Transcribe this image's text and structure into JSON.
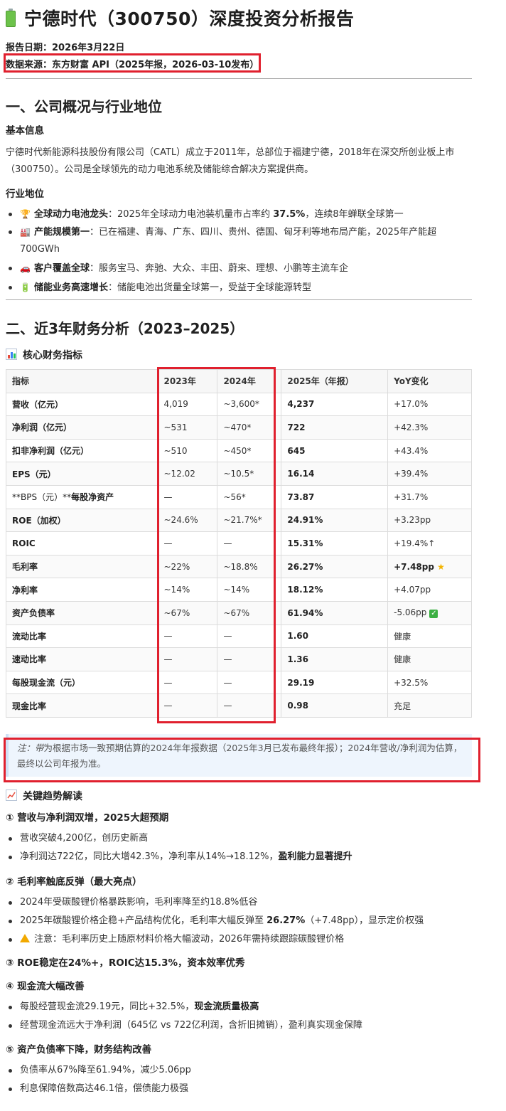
{
  "title": "宁德时代（300750）深度投资分析报告",
  "report_date": "报告日期：2026年3月22日",
  "data_source": "数据来源：东方财富 API（2025年报，2026-03-10发布）",
  "section1": {
    "heading": "一、公司概况与行业地位",
    "basic_title": "基本信息",
    "basic_text": "宁德时代新能源科技股份有限公司（CATL）成立于2011年，总部位于福建宁德，2018年在深交所创业板上市（300750）。公司是全球领先的动力电池系统及储能综合解决方案提供商。",
    "industry_title": "行业地位",
    "items": [
      {
        "icon": "trophy-icon",
        "emoji": "🏆",
        "bold": "全球动力电池龙头",
        "pre": "：2025年全球动力电池装机量市占率约 ",
        "hl": "37.5%",
        "post": "，连续8年蝉联全球第一"
      },
      {
        "icon": "factory-icon",
        "emoji": "🏭",
        "bold": "产能规模第一",
        "pre": "：已在福建、青海、广东、四川、贵州、德国、匈牙利等地布局产能，2025年产能超700GWh",
        "hl": "",
        "post": ""
      },
      {
        "icon": "car-icon",
        "emoji": "🚗",
        "bold": "客户覆盖全球",
        "pre": "：服务宝马、奔驰、大众、丰田、蔚来、理想、小鹏等主流车企",
        "hl": "",
        "post": ""
      },
      {
        "icon": "battery-icon",
        "emoji": "🔋",
        "bold": "储能业务高速增长",
        "pre": "：储能电池出货量全球第一，受益于全球能源转型",
        "hl": "",
        "post": ""
      }
    ]
  },
  "section2": {
    "heading": "二、近3年财务分析（2023–2025）",
    "table_title": "核心财务指标",
    "headers": [
      "指标",
      "2023年",
      "2024年",
      "2025年（年报）",
      "YoY变化"
    ],
    "rows": [
      [
        "营收（亿元）",
        "4,019",
        "~3,600*",
        "4,237",
        "+17.0%"
      ],
      [
        "净利润（亿元）",
        "~531",
        "~470*",
        "722",
        "+42.3%"
      ],
      [
        "扣非净利润（亿元）",
        "~510",
        "~450*",
        "645",
        "+43.4%"
      ],
      [
        "EPS（元）",
        "~12.02",
        "~10.5*",
        "16.14",
        "+39.4%"
      ],
      [
        "**BPS（元）**每股净资产",
        "—",
        "~56*",
        "73.87",
        "+31.7%"
      ],
      [
        "ROE（加权）",
        "~24.6%",
        "~21.7%*",
        "24.91%",
        "+3.23pp"
      ],
      [
        "ROIC",
        "—",
        "—",
        "15.31%",
        "+19.4%↑"
      ],
      [
        "毛利率",
        "~22%",
        "~18.8%",
        "26.27%",
        "+7.48pp"
      ],
      [
        "净利率",
        "~14%",
        "~14%",
        "18.12%",
        "+4.07pp"
      ],
      [
        "资产负债率",
        "~67%",
        "~67%",
        "61.94%",
        "-5.06pp"
      ],
      [
        "流动比率",
        "—",
        "—",
        "1.60",
        "健康"
      ],
      [
        "速动比率",
        "—",
        "—",
        "1.36",
        "健康"
      ],
      [
        "每股现金流（元）",
        "—",
        "—",
        "29.19",
        "+32.5%"
      ],
      [
        "现金比率",
        "—",
        "—",
        "0.98",
        "充足"
      ]
    ],
    "note_prefix": "注：",
    "note_italic": "带",
    "note_text": "为根据市场一致预期估算的2024年年报数据（2025年3月已发布最终年报）；2024年营收/净利润为估算，最终以公司年报为准。",
    "trend_title": "关键趋势解读",
    "t1_title": "① 营收与净利润双增，2025大超预期",
    "t1_items": [
      "营收突破4,200亿，创历史新高",
      "净利润达722亿，同比大增42.3%，净利率从14%→18.12%，"
    ],
    "t1_bold": "盈利能力显著提升",
    "t2_title": "② 毛利率触底反弹（最大亮点）",
    "t2_item1": "2024年受碳酸锂价格暴跌影响，毛利率降至约18.8%低谷",
    "t2_item2_pre": "2025年碳酸锂价格企稳+产品结构优化，毛利率大幅反弹至 ",
    "t2_item2_bold": "26.27%",
    "t2_item2_post": "（+7.48pp），显示定价权强",
    "t2_item3": "注意：毛利率历史上随原材料价格大幅波动，2026年需持续跟踪碳酸锂价格",
    "t3_title": "③ ROE稳定在24%+，ROIC达15.3%，资本效率优秀",
    "t4_title": "④ 现金流大幅改善",
    "t4_item1_pre": "每股经营现金流29.19元，同比+32.5%，",
    "t4_item1_bold": "现金流质量极高",
    "t4_item2": "经营现金流远大于净利润（645亿 vs 722亿利润，含折旧摊销），盈利真实现金保障",
    "t5_title": "⑤ 资产负债率下降，财务结构改善",
    "t5_item1": "负债率从67%降至61.94%，减少5.06pp",
    "t5_item2": "利息保障倍数高达46.1倍，偿债能力极强"
  }
}
